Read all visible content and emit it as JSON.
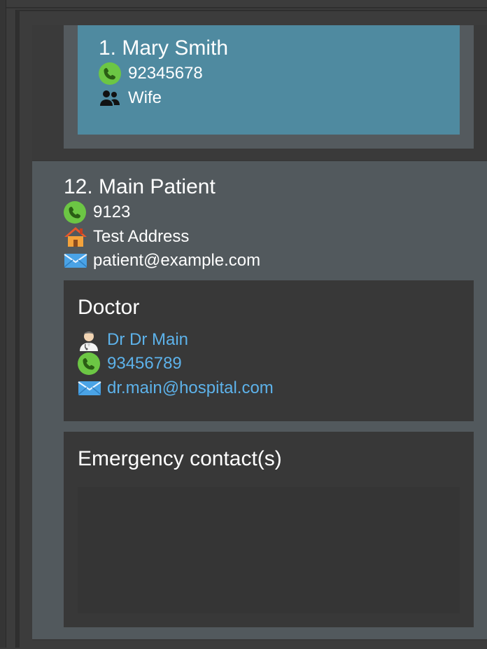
{
  "emergency_contact": {
    "name": "1. Mary Smith",
    "phone": "92345678",
    "relationship": "Wife"
  },
  "patient": {
    "name": "12. Main Patient",
    "phone": "9123",
    "address": "Test Address",
    "email": "patient@example.com"
  },
  "doctor": {
    "section_title": "Doctor",
    "name": "Dr Dr Main",
    "phone": "93456789",
    "email": "dr.main@hospital.com"
  },
  "emergency_section": {
    "title": "Emergency contact(s)"
  },
  "icons": {
    "phone": "phone-icon",
    "people": "people-icon",
    "home": "home-icon",
    "mail": "mail-icon",
    "doctor": "doctor-icon"
  },
  "colors": {
    "selected": "#4f8aa0",
    "patient_bg": "#52595d",
    "link": "#5db2ea"
  }
}
